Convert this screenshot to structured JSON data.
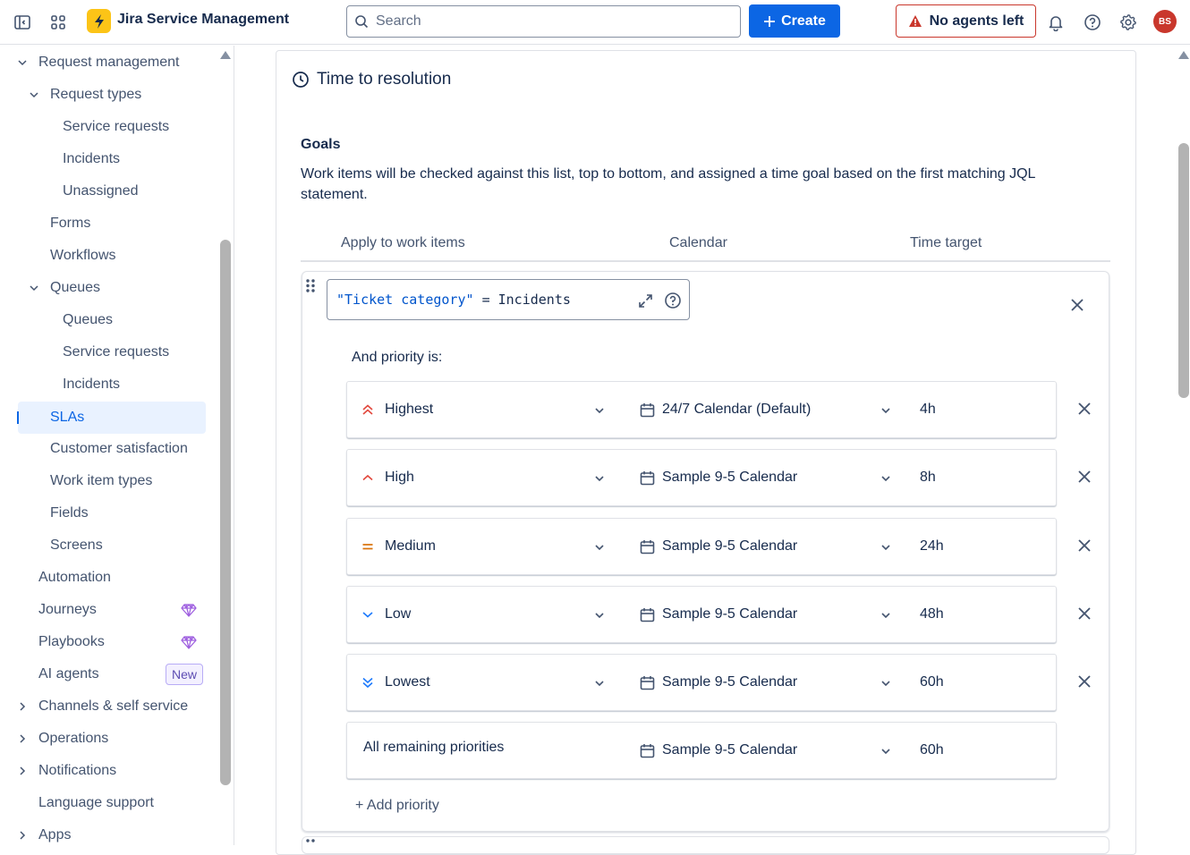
{
  "topbar": {
    "app_title": "Jira Service Management",
    "search_placeholder": "Search",
    "create_label": "Create",
    "agents_label": "No agents left",
    "avatar_initials": "BS",
    "brand_color": "#0c66e4"
  },
  "sidebar": {
    "items": [
      {
        "label": "Request management",
        "level": 1,
        "expanded": true
      },
      {
        "label": "Request types",
        "level": 2,
        "expanded": true
      },
      {
        "label": "Service requests",
        "level": 3
      },
      {
        "label": "Incidents",
        "level": 3
      },
      {
        "label": "Unassigned",
        "level": 3
      },
      {
        "label": "Forms",
        "level": 2
      },
      {
        "label": "Workflows",
        "level": 2
      },
      {
        "label": "Queues",
        "level": 2,
        "expanded": true
      },
      {
        "label": "Queues",
        "level": 3
      },
      {
        "label": "Service requests",
        "level": 3
      },
      {
        "label": "Incidents",
        "level": 3
      },
      {
        "label": "SLAs",
        "level": 2,
        "selected": true
      },
      {
        "label": "Customer satisfaction",
        "level": 2
      },
      {
        "label": "Work item types",
        "level": 2
      },
      {
        "label": "Fields",
        "level": 2
      },
      {
        "label": "Screens",
        "level": 2
      },
      {
        "label": "Automation",
        "level": 1
      },
      {
        "label": "Journeys",
        "level": 1,
        "icon": "gem-icon"
      },
      {
        "label": "Playbooks",
        "level": 1,
        "icon": "gem-icon"
      },
      {
        "label": "AI agents",
        "level": 1,
        "badge": "New"
      },
      {
        "label": "Channels & self service",
        "level": 1,
        "collapsed": true
      },
      {
        "label": "Operations",
        "level": 1,
        "collapsed": true
      },
      {
        "label": "Notifications",
        "level": 1,
        "collapsed": true
      },
      {
        "label": "Language support",
        "level": 1
      },
      {
        "label": "Apps",
        "level": 1,
        "collapsed": true
      }
    ]
  },
  "main": {
    "section_title": "Time to resolution",
    "goals_heading": "Goals",
    "goals_description": "Work items will be checked against this list, top to bottom, and assigned a time goal based on the first matching JQL statement.",
    "columns": [
      "Apply to work items",
      "Calendar",
      "Time target"
    ],
    "jql": {
      "field": "\"Ticket category\"",
      "operator": "=",
      "value": "Incidents"
    },
    "and_priority_label": "And priority is:",
    "priorities": [
      {
        "priority": "Highest",
        "icon": "priority-highest-icon",
        "calendar": "24/7 Calendar (Default)",
        "target": "4h"
      },
      {
        "priority": "High",
        "icon": "priority-high-icon",
        "calendar": "Sample 9-5 Calendar",
        "target": "8h"
      },
      {
        "priority": "Medium",
        "icon": "priority-medium-icon",
        "calendar": "Sample 9-5 Calendar",
        "target": "24h"
      },
      {
        "priority": "Low",
        "icon": "priority-low-icon",
        "calendar": "Sample 9-5 Calendar",
        "target": "48h"
      },
      {
        "priority": "Lowest",
        "icon": "priority-lowest-icon",
        "calendar": "Sample 9-5 Calendar",
        "target": "60h"
      }
    ],
    "remaining": {
      "label": "All remaining priorities",
      "calendar": "Sample 9-5 Calendar",
      "target": "60h"
    },
    "add_priority_label": "+ Add priority"
  }
}
